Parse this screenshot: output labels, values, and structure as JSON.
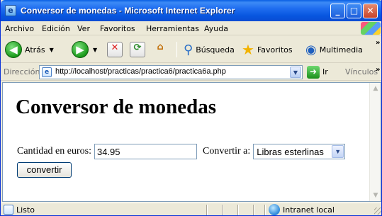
{
  "window": {
    "title": "Conversor de monedas - Microsoft Internet Explorer"
  },
  "menu": [
    "Archivo",
    "Edición",
    "Ver",
    "Favoritos",
    "Herramientas",
    "Ayuda"
  ],
  "toolbar": {
    "back_label": "Atrás",
    "search_label": "Búsqueda",
    "favorites_label": "Favoritos",
    "multimedia_label": "Multimedia"
  },
  "address": {
    "label": "Dirección",
    "url": "http://localhost/practicas/practica6/practica6a.php",
    "go_label": "Ir",
    "links_label": "Vínculos"
  },
  "page": {
    "heading": "Conversor de monedas",
    "amount_label": "Cantidad en euros:",
    "amount_value": "34.95",
    "convert_to_label": "Convertir a:",
    "currency_selected": "Libras esterlinas",
    "submit_label": "convertir"
  },
  "status": {
    "text": "Listo",
    "zone": "Intranet local"
  }
}
